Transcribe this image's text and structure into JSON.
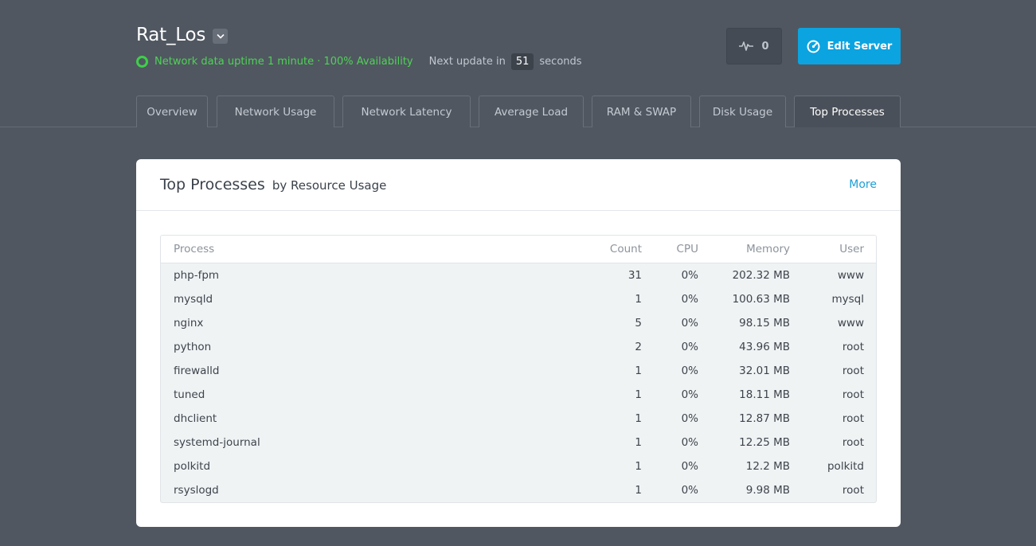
{
  "server": {
    "name": "Rat_Los",
    "status_text": "Network data uptime 1 minute · 100% Availability",
    "next_update_label": "Next update in",
    "countdown": "51",
    "seconds_label": "seconds"
  },
  "actions": {
    "activity_count": "0",
    "activity_icon": "pulse-icon",
    "edit_label": "Edit Server",
    "edit_icon": "gauge-icon"
  },
  "tabs": [
    {
      "label": "Overview"
    },
    {
      "label": "Network Usage"
    },
    {
      "label": "Network Latency"
    },
    {
      "label": "Average Load"
    },
    {
      "label": "RAM & SWAP"
    },
    {
      "label": "Disk Usage"
    },
    {
      "label": "Top Processes",
      "active": true
    }
  ],
  "card": {
    "title": "Top Processes",
    "subtitle": "by Resource Usage",
    "more_label": "More"
  },
  "table": {
    "headers": {
      "process": "Process",
      "count": "Count",
      "cpu": "CPU",
      "memory": "Memory",
      "user": "User"
    },
    "rows": [
      {
        "process": "php-fpm",
        "count": "31",
        "cpu": "0%",
        "memory": "202.32 MB",
        "user": "www"
      },
      {
        "process": "mysqld",
        "count": "1",
        "cpu": "0%",
        "memory": "100.63 MB",
        "user": "mysql"
      },
      {
        "process": "nginx",
        "count": "5",
        "cpu": "0%",
        "memory": "98.15 MB",
        "user": "www"
      },
      {
        "process": "python",
        "count": "2",
        "cpu": "0%",
        "memory": "43.96 MB",
        "user": "root"
      },
      {
        "process": "firewalld",
        "count": "1",
        "cpu": "0%",
        "memory": "32.01 MB",
        "user": "root"
      },
      {
        "process": "tuned",
        "count": "1",
        "cpu": "0%",
        "memory": "18.11 MB",
        "user": "root"
      },
      {
        "process": "dhclient",
        "count": "1",
        "cpu": "0%",
        "memory": "12.87 MB",
        "user": "root"
      },
      {
        "process": "systemd-journal",
        "count": "1",
        "cpu": "0%",
        "memory": "12.25 MB",
        "user": "root"
      },
      {
        "process": "polkitd",
        "count": "1",
        "cpu": "0%",
        "memory": "12.2 MB",
        "user": "polkitd"
      },
      {
        "process": "rsyslogd",
        "count": "1",
        "cpu": "0%",
        "memory": "9.98 MB",
        "user": "root"
      }
    ]
  },
  "colors": {
    "background": "#505761",
    "status_green": "#4fd255",
    "accent_blue": "#0ba4e0",
    "link_blue": "#1ea0d8"
  }
}
